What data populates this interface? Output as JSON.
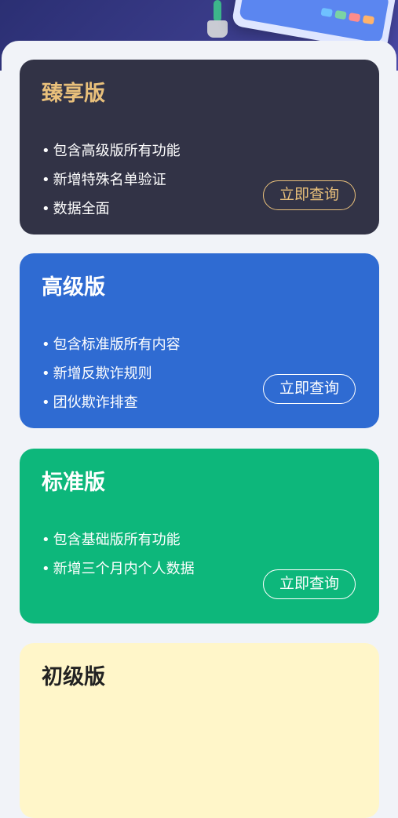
{
  "plans": [
    {
      "name": "臻享版",
      "features": [
        "包含高级版所有功能",
        "新增特殊名单验证",
        "数据全面"
      ],
      "button": "立即查询",
      "bg": "#323346",
      "accent": "#e9c07b"
    },
    {
      "name": "高级版",
      "features": [
        "包含标准版所有内容",
        "新增反欺诈规则",
        "团伙欺诈排查"
      ],
      "button": "立即查询",
      "bg": "#2f6bd2"
    },
    {
      "name": "标准版",
      "features": [
        "包含基础版所有功能",
        "新增三个月内个人数据"
      ],
      "button": "立即查询",
      "bg": "#0db77b"
    },
    {
      "name": "初级版",
      "bg": "#fff6c9"
    }
  ]
}
